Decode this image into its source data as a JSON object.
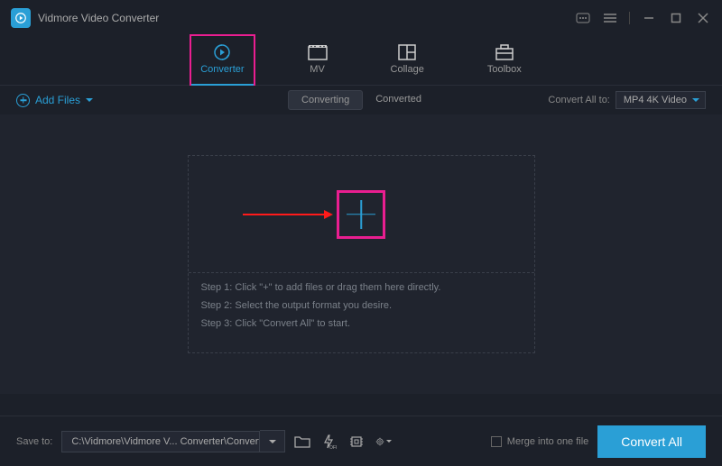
{
  "app": {
    "title": "Vidmore Video Converter"
  },
  "nav_tabs": [
    {
      "label": "Converter",
      "active": true
    },
    {
      "label": "MV",
      "active": false
    },
    {
      "label": "Collage",
      "active": false
    },
    {
      "label": "Toolbox",
      "active": false
    }
  ],
  "toolbar": {
    "add_files": "Add Files",
    "subtabs": {
      "converting": "Converting",
      "converted": "Converted"
    },
    "convert_all_to_label": "Convert All to:",
    "format_value": "MP4 4K Video"
  },
  "dropzone": {
    "step1": "Step 1: Click \"+\" to add files or drag them here directly.",
    "step2": "Step 2: Select the output format you desire.",
    "step3": "Step 3: Click \"Convert All\" to start."
  },
  "footer": {
    "save_to_label": "Save to:",
    "save_path": "C:\\Vidmore\\Vidmore V... Converter\\Converted",
    "merge_label": "Merge into one file",
    "convert_button": "Convert All"
  }
}
